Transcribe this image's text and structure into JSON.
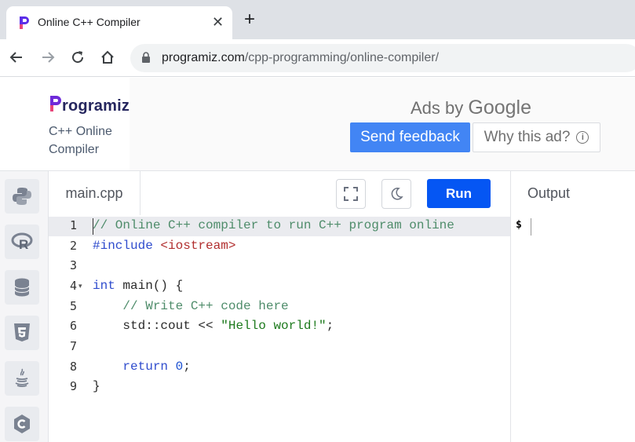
{
  "browser": {
    "tab_title": "Online C++ Compiler",
    "tab_close": "✕",
    "new_tab": "+",
    "url_domain": "programiz.com",
    "url_path": "/cpp-programming/online-compiler/"
  },
  "header": {
    "logo_text": "rogramiz",
    "subtitle": "C++ Online Compiler",
    "collapse_arrow": "←"
  },
  "ad": {
    "ads_by": "Ads by",
    "google": "Google",
    "send_feedback": "Send feedback",
    "why_this_ad": "Why this ad?",
    "info_icon": "i"
  },
  "sidebar": {
    "languages": [
      "python-icon",
      "r-icon",
      "sql-icon",
      "html5-icon",
      "java-icon",
      "c-icon"
    ]
  },
  "editor": {
    "file_name": "main.cpp",
    "run_label": "Run",
    "line_numbers": [
      "1",
      "2",
      "3",
      "4",
      "5",
      "6",
      "7",
      "8",
      "9"
    ],
    "fold_marker": "▾",
    "lines": {
      "l1_comment": "// Online C++ compiler to run C++ program online",
      "l2_include": "#include",
      "l2_header": "<iostream>",
      "l4_type": "int",
      "l4_rest": " main() {",
      "l5_comment": "// Write C++ code here",
      "l6_code": "std::cout << ",
      "l6_string": "\"Hello world!\"",
      "l6_end": ";",
      "l8_kw": "return",
      "l8_num": "0",
      "l8_end": ";",
      "l9": "}"
    }
  },
  "output": {
    "title": "Output",
    "prompt": "$"
  },
  "colors": {
    "run_button": "#0556f3",
    "send_feedback": "#4285f4",
    "brand_purple": "#6e2bd9"
  }
}
